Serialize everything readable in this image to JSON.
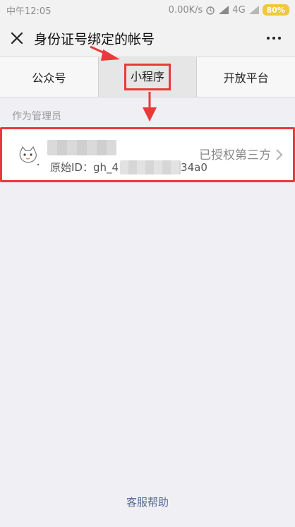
{
  "status_bar": {
    "time": "中午12:05",
    "network_speed": "0.00K/s",
    "signal": "4G",
    "battery": "80%"
  },
  "title_bar": {
    "title": "身份证号绑定的帐号"
  },
  "tabs": [
    {
      "label": "公众号"
    },
    {
      "label": "小程序"
    },
    {
      "label": "开放平台"
    }
  ],
  "section": {
    "header": "作为管理员"
  },
  "account": {
    "id_prefix": "原始ID：gh_4",
    "id_suffix": "34a0",
    "status": "已授权第三方"
  },
  "footer": {
    "help_link": "客服帮助"
  },
  "colors": {
    "highlight_red": "#e83a3a",
    "link_blue": "#576b95",
    "battery_yellow": "#f0c840"
  }
}
